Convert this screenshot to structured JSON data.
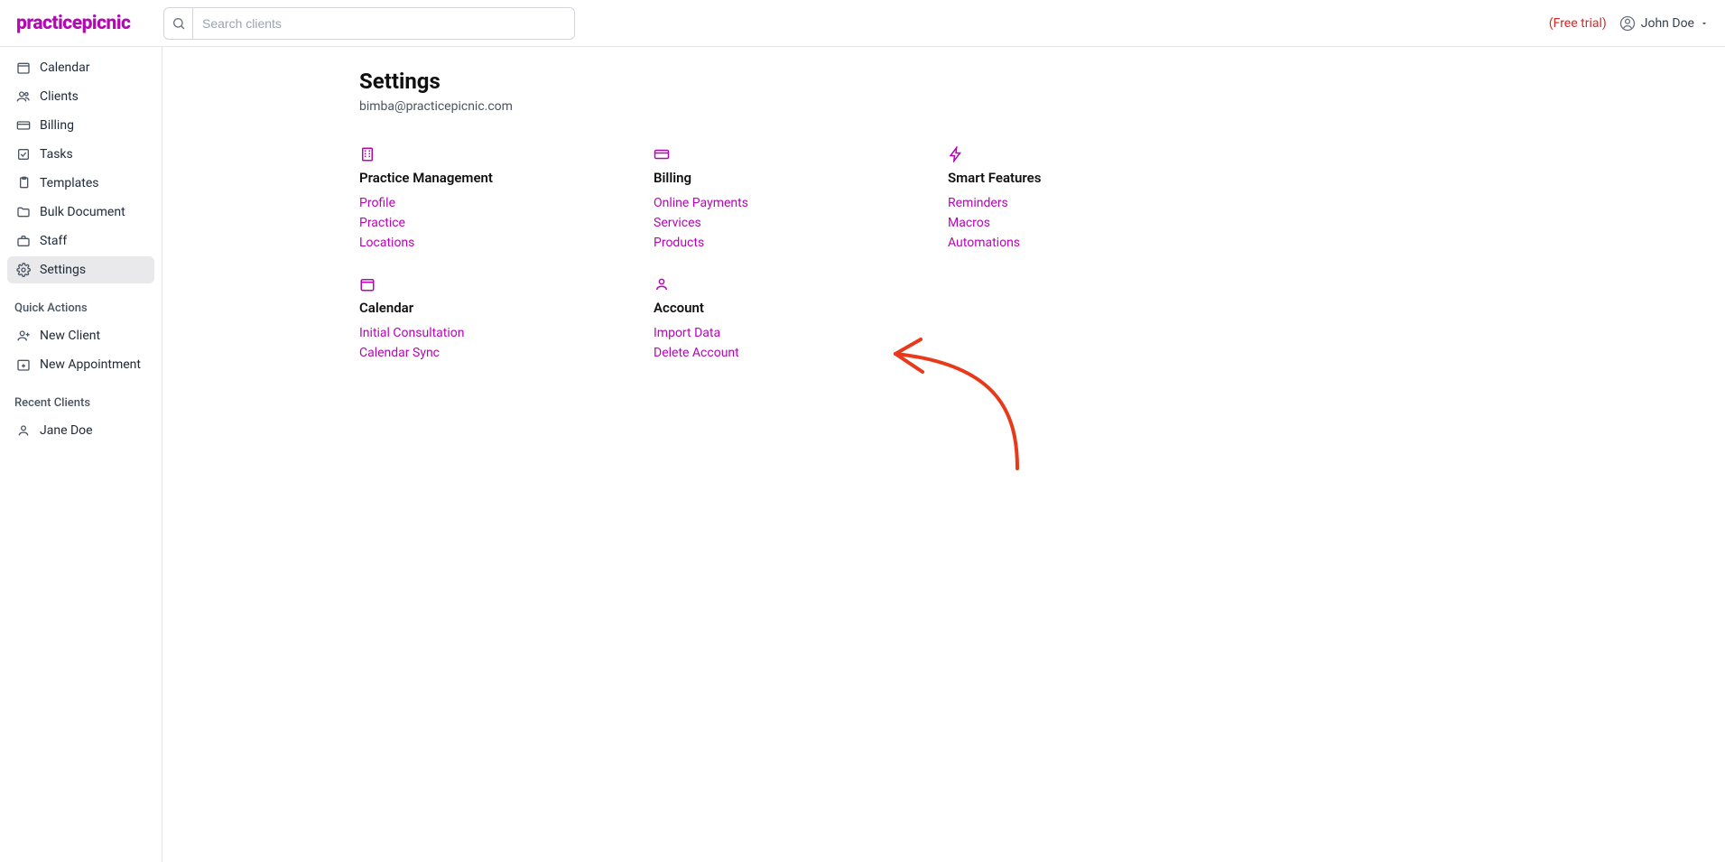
{
  "brand": "practicepicnic",
  "search": {
    "placeholder": "Search clients"
  },
  "header": {
    "trial": "(Free trial)",
    "user": "John Doe"
  },
  "sidebar": {
    "nav": [
      {
        "label": "Calendar"
      },
      {
        "label": "Clients"
      },
      {
        "label": "Billing"
      },
      {
        "label": "Tasks"
      },
      {
        "label": "Templates"
      },
      {
        "label": "Bulk Document"
      },
      {
        "label": "Staff"
      },
      {
        "label": "Settings"
      }
    ],
    "quick_actions_label": "Quick Actions",
    "quick_actions": [
      {
        "label": "New Client"
      },
      {
        "label": "New Appointment"
      }
    ],
    "recent_clients_label": "Recent Clients",
    "recent_clients": [
      {
        "label": "Jane Doe"
      }
    ]
  },
  "page": {
    "title": "Settings",
    "subtitle": "bimba@practicepicnic.com"
  },
  "settings": {
    "practice_management": {
      "title": "Practice Management",
      "links": {
        "profile": "Profile",
        "practice": "Practice",
        "locations": "Locations"
      }
    },
    "billing": {
      "title": "Billing",
      "links": {
        "online_payments": "Online Payments",
        "services": "Services",
        "products": "Products"
      }
    },
    "smart_features": {
      "title": "Smart Features",
      "links": {
        "reminders": "Reminders",
        "macros": "Macros",
        "automations": "Automations"
      }
    },
    "calendar": {
      "title": "Calendar",
      "links": {
        "initial_consultation": "Initial Consultation",
        "calendar_sync": "Calendar Sync"
      }
    },
    "account": {
      "title": "Account",
      "links": {
        "import_data": "Import Data",
        "delete_account": "Delete Account"
      }
    }
  }
}
